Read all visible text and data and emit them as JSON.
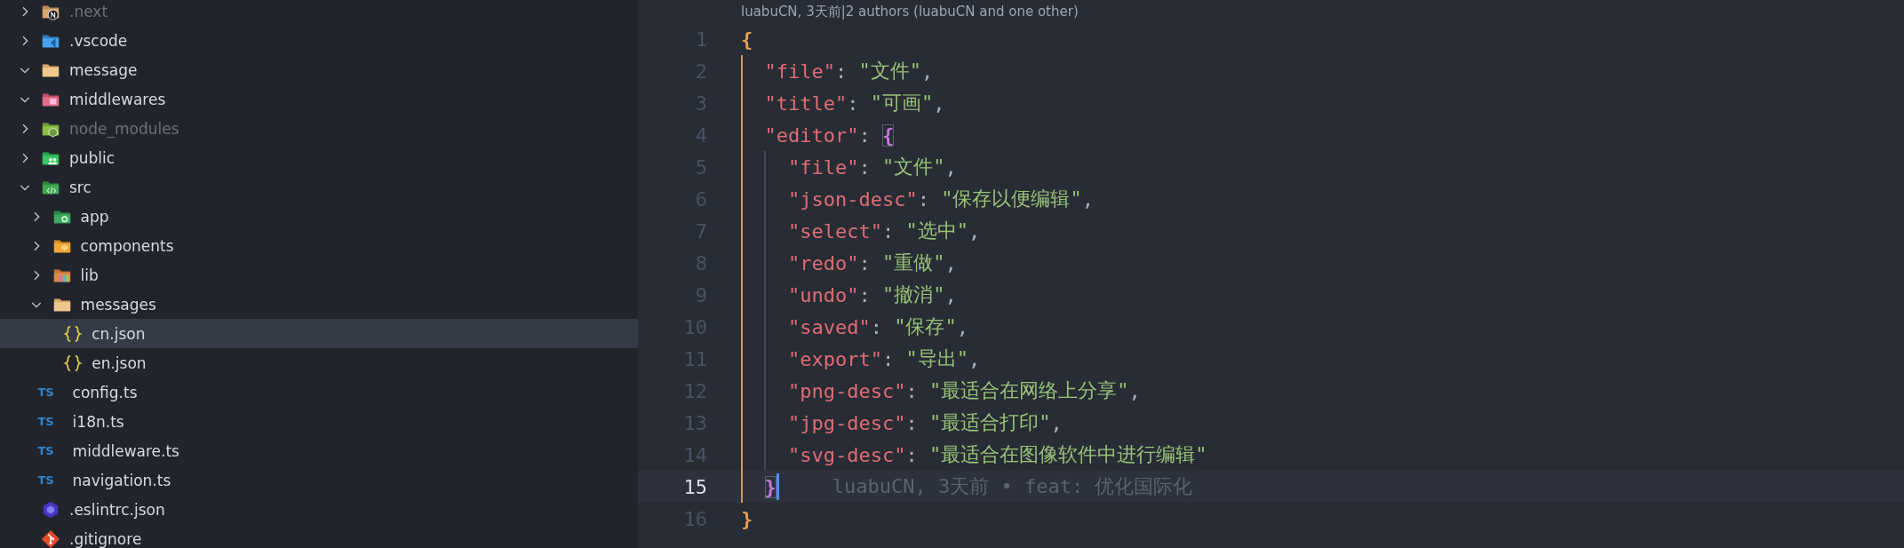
{
  "sidebar": {
    "tree": [
      {
        "name": ".next",
        "kind": "next",
        "expanded": false,
        "ignored": true,
        "selected": false
      },
      {
        "name": ".vscode",
        "kind": "vscode",
        "expanded": false,
        "ignored": false,
        "selected": false
      },
      {
        "name": "message",
        "kind": "plain",
        "expanded": true,
        "ignored": false,
        "selected": false
      },
      {
        "name": "middlewares",
        "kind": "middleware",
        "expanded": true,
        "ignored": false,
        "selected": false
      },
      {
        "name": "node_modules",
        "kind": "node",
        "expanded": false,
        "ignored": true,
        "selected": false
      },
      {
        "name": "public",
        "kind": "public",
        "expanded": false,
        "ignored": false,
        "selected": false
      },
      {
        "name": "src",
        "kind": "src",
        "expanded": true,
        "ignored": false,
        "selected": false,
        "children": [
          {
            "name": "app",
            "kind": "app",
            "expanded": false,
            "ignored": false,
            "selected": false
          },
          {
            "name": "components",
            "kind": "components",
            "expanded": false,
            "ignored": false,
            "selected": false
          },
          {
            "name": "lib",
            "kind": "lib",
            "expanded": false,
            "ignored": false,
            "selected": false
          },
          {
            "name": "messages",
            "kind": "plain",
            "expanded": true,
            "ignored": false,
            "selected": false,
            "children": [
              {
                "name": "cn.json",
                "kind": "json",
                "ignored": false,
                "selected": true
              },
              {
                "name": "en.json",
                "kind": "json",
                "ignored": false,
                "selected": false
              }
            ]
          },
          {
            "name": "config.ts",
            "kind": "ts",
            "badge": "TS",
            "ignored": false,
            "selected": false
          },
          {
            "name": "i18n.ts",
            "kind": "ts",
            "badge": "TS",
            "ignored": false,
            "selected": false
          },
          {
            "name": "middleware.ts",
            "kind": "ts",
            "badge": "TS",
            "ignored": false,
            "selected": false
          },
          {
            "name": "navigation.ts",
            "kind": "ts",
            "badge": "TS",
            "ignored": false,
            "selected": false
          }
        ]
      },
      {
        "name": ".eslintrc.json",
        "kind": "eslint",
        "ignored": false,
        "selected": false
      },
      {
        "name": ".gitignore",
        "kind": "git",
        "ignored": false,
        "selected": false
      }
    ]
  },
  "editor": {
    "codelens": "luabuCN, 3天前|2 authors (luabuCN and one other)",
    "lines": [
      {
        "number": "1",
        "current": false,
        "tokens": [
          {
            "kind": "brace",
            "text": "{",
            "color": "#e5a04f",
            "matched": false
          }
        ]
      },
      {
        "number": "2",
        "current": false,
        "tokens": [
          {
            "kind": "key",
            "text": "  \"file\""
          },
          {
            "kind": "punct",
            "text": ": "
          },
          {
            "kind": "string",
            "text": "\"文件\""
          },
          {
            "kind": "punct",
            "text": ","
          }
        ]
      },
      {
        "number": "3",
        "current": false,
        "tokens": [
          {
            "kind": "key",
            "text": "  \"title\""
          },
          {
            "kind": "punct",
            "text": ": "
          },
          {
            "kind": "string",
            "text": "\"可画\""
          },
          {
            "kind": "punct",
            "text": ","
          }
        ]
      },
      {
        "number": "4",
        "current": false,
        "tokens": [
          {
            "kind": "key",
            "text": "  \"editor\""
          },
          {
            "kind": "punct",
            "text": ": "
          },
          {
            "kind": "brace",
            "text": "{",
            "color": "#c678dd",
            "matched": true
          }
        ]
      },
      {
        "number": "5",
        "current": false,
        "tokens": [
          {
            "kind": "key",
            "text": "    \"file\""
          },
          {
            "kind": "punct",
            "text": ": "
          },
          {
            "kind": "string",
            "text": "\"文件\""
          },
          {
            "kind": "punct",
            "text": ","
          }
        ]
      },
      {
        "number": "6",
        "current": false,
        "tokens": [
          {
            "kind": "key",
            "text": "    \"json-desc\""
          },
          {
            "kind": "punct",
            "text": ": "
          },
          {
            "kind": "string",
            "text": "\"保存以便编辑\""
          },
          {
            "kind": "punct",
            "text": ","
          }
        ]
      },
      {
        "number": "7",
        "current": false,
        "tokens": [
          {
            "kind": "key",
            "text": "    \"select\""
          },
          {
            "kind": "punct",
            "text": ": "
          },
          {
            "kind": "string",
            "text": "\"选中\""
          },
          {
            "kind": "punct",
            "text": ","
          }
        ]
      },
      {
        "number": "8",
        "current": false,
        "tokens": [
          {
            "kind": "key",
            "text": "    \"redo\""
          },
          {
            "kind": "punct",
            "text": ": "
          },
          {
            "kind": "string",
            "text": "\"重做\""
          },
          {
            "kind": "punct",
            "text": ","
          }
        ]
      },
      {
        "number": "9",
        "current": false,
        "tokens": [
          {
            "kind": "key",
            "text": "    \"undo\""
          },
          {
            "kind": "punct",
            "text": ": "
          },
          {
            "kind": "string",
            "text": "\"撤消\""
          },
          {
            "kind": "punct",
            "text": ","
          }
        ]
      },
      {
        "number": "10",
        "current": false,
        "tokens": [
          {
            "kind": "key",
            "text": "    \"saved\""
          },
          {
            "kind": "punct",
            "text": ": "
          },
          {
            "kind": "string",
            "text": "\"保存\""
          },
          {
            "kind": "punct",
            "text": ","
          }
        ]
      },
      {
        "number": "11",
        "current": false,
        "tokens": [
          {
            "kind": "key",
            "text": "    \"export\""
          },
          {
            "kind": "punct",
            "text": ": "
          },
          {
            "kind": "string",
            "text": "\"导出\""
          },
          {
            "kind": "punct",
            "text": ","
          }
        ]
      },
      {
        "number": "12",
        "current": false,
        "tokens": [
          {
            "kind": "key",
            "text": "    \"png-desc\""
          },
          {
            "kind": "punct",
            "text": ": "
          },
          {
            "kind": "string",
            "text": "\"最适合在网络上分享\""
          },
          {
            "kind": "punct",
            "text": ","
          }
        ]
      },
      {
        "number": "13",
        "current": false,
        "tokens": [
          {
            "kind": "key",
            "text": "    \"jpg-desc\""
          },
          {
            "kind": "punct",
            "text": ": "
          },
          {
            "kind": "string",
            "text": "\"最适合打印\""
          },
          {
            "kind": "punct",
            "text": ","
          }
        ]
      },
      {
        "number": "14",
        "current": false,
        "tokens": [
          {
            "kind": "key",
            "text": "    \"svg-desc\""
          },
          {
            "kind": "punct",
            "text": ": "
          },
          {
            "kind": "string",
            "text": "\"最适合在图像软件中进行编辑\""
          }
        ]
      },
      {
        "number": "15",
        "current": true,
        "blame": "luabuCN, 3天前 • feat: 优化国际化",
        "tokens": [
          {
            "kind": "brace",
            "text": "  }",
            "color": "#c678dd",
            "matched": true
          }
        ]
      },
      {
        "number": "16",
        "current": false,
        "tokens": [
          {
            "kind": "brace",
            "text": "}",
            "color": "#e5a04f",
            "matched": false
          }
        ]
      }
    ]
  }
}
